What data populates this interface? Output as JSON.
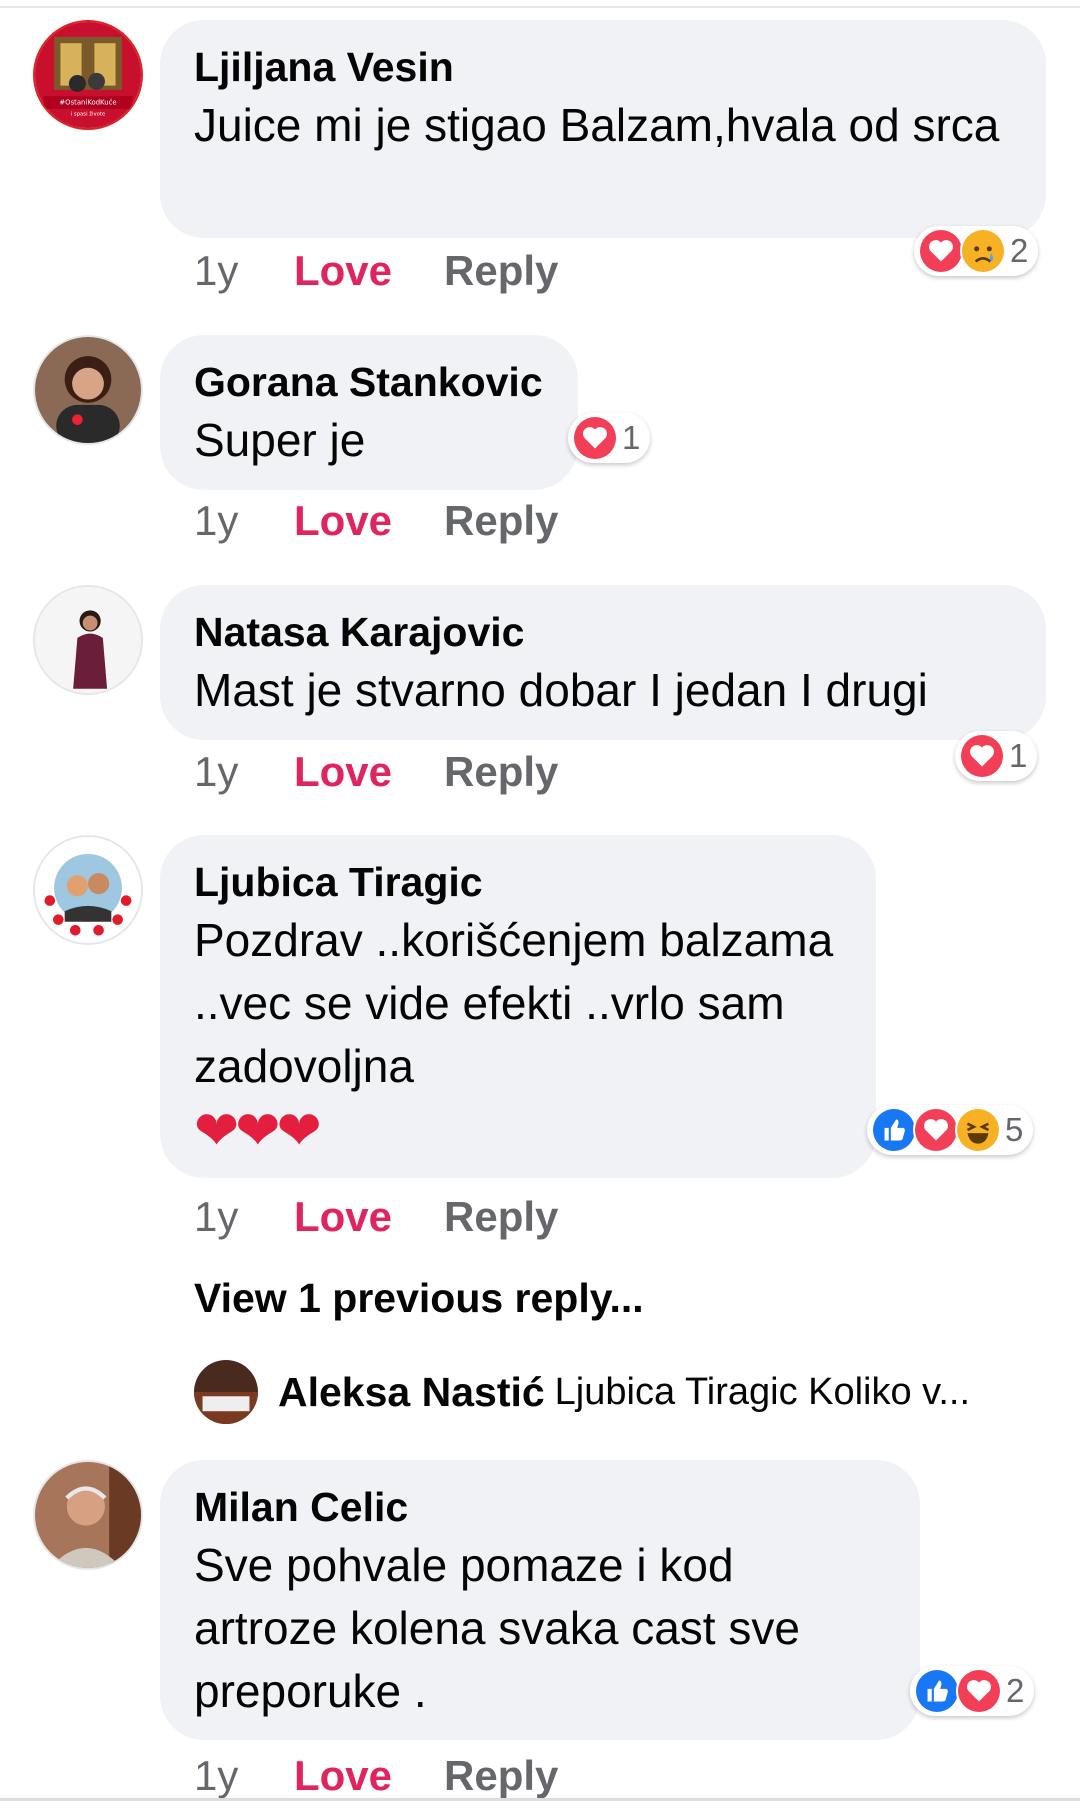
{
  "comments": [
    {
      "author": "Ljiljana Vesin",
      "text": "Juice mi je stigao Balzam,hvala od srca",
      "avatar_badge": "#OstaniKodKuće",
      "avatar_badge_sub": "i spasi živote",
      "reactions": [
        "love",
        "sad"
      ],
      "reaction_count": "2",
      "time": "1y",
      "love_label": "Love",
      "reply_label": "Reply"
    },
    {
      "author": "Gorana Stankovic",
      "text": "Super je",
      "reactions": [
        "love"
      ],
      "reaction_count": "1",
      "time": "1y",
      "love_label": "Love",
      "reply_label": "Reply"
    },
    {
      "author": "Natasa Karajovic",
      "text": "Mast je stvarno dobar I jedan I drugi",
      "reactions": [
        "love"
      ],
      "reaction_count": "1",
      "time": "1y",
      "love_label": "Love",
      "reply_label": "Reply"
    },
    {
      "author": "Ljubica Tiragic",
      "text": "Pozdrav ..korišćenjem balzama ..vec se vide efekti ..vrlo sam zadovoljna",
      "emoji": "❤❤❤",
      "reactions": [
        "like",
        "love",
        "haha"
      ],
      "reaction_count": "5",
      "time": "1y",
      "love_label": "Love",
      "reply_label": "Reply",
      "view_previous": "View 1 previous reply...",
      "reply_preview": {
        "author": "Aleksa Nastić",
        "text": "Ljubica Tiragic Koliko v..."
      }
    },
    {
      "author": "Milan Celic",
      "text": "Sve pohvale pomaze i kod artroze kolena svaka cast sve preporuke .",
      "reactions": [
        "like",
        "love"
      ],
      "reaction_count": "2",
      "time": "1y",
      "love_label": "Love",
      "reply_label": "Reply"
    }
  ],
  "colors": {
    "bubble": "#f0f2f5",
    "love_action": "#e0245e",
    "secondary_text": "#65676b",
    "like_blue": "#1877f2",
    "love_red": "#f33e58",
    "emoji_yellow": "#f7b125"
  }
}
